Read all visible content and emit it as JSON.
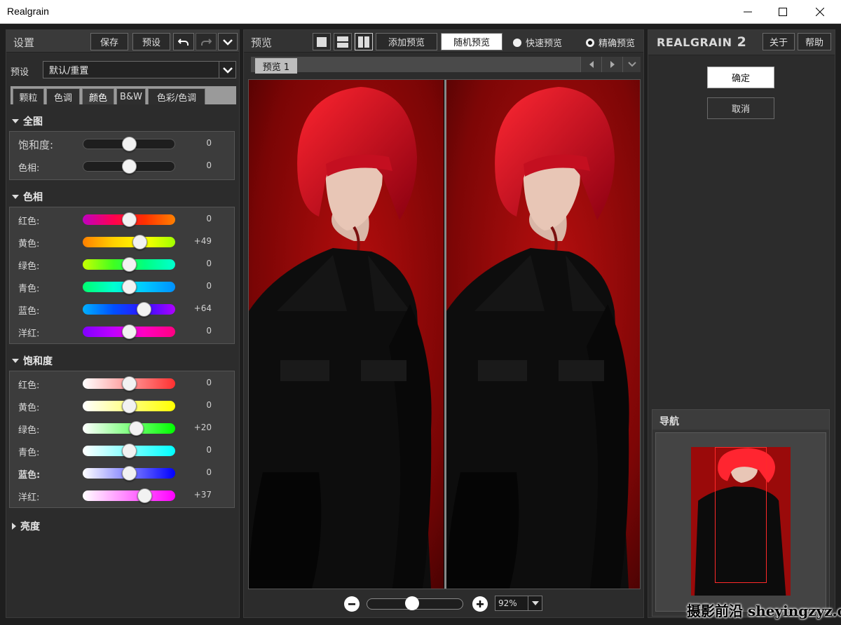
{
  "window": {
    "title": "Realgrain"
  },
  "left": {
    "header": {
      "title": "设置",
      "save_label": "保存",
      "preset_label": "预设"
    },
    "preset": {
      "label": "预设",
      "value": "默认/重置"
    },
    "tabs": [
      "颗粒",
      "色调",
      "颜色",
      "B&W",
      "色彩/色调"
    ],
    "sections": {
      "overall": {
        "title": "全图",
        "rows": [
          {
            "label": "饱和度:",
            "value": "0",
            "level": 0.5
          },
          {
            "label": "色相:",
            "value": "0",
            "level": 0.5
          }
        ]
      },
      "hue": {
        "title": "色相",
        "rows": [
          {
            "label": "红色:",
            "value": "0",
            "level": 0.5,
            "gradient": "linear-gradient(90deg,#c000c0,#ff0050,#ff3000,#ff8000)"
          },
          {
            "label": "黄色:",
            "value": "+49",
            "level": 0.62,
            "gradient": "linear-gradient(90deg,#ff8000,#ffd000,#ffff00,#a0ff00)"
          },
          {
            "label": "绿色:",
            "value": "0",
            "level": 0.5,
            "gradient": "linear-gradient(90deg,#c8ff00,#40ff20,#00ff80,#00ffd0)"
          },
          {
            "label": "青色:",
            "value": "0",
            "level": 0.5,
            "gradient": "linear-gradient(90deg,#00ff70,#00ffd0,#00c8ff,#0090ff)"
          },
          {
            "label": "蓝色:",
            "value": "+64",
            "level": 0.66,
            "gradient": "linear-gradient(90deg,#00b0ff,#0050ff,#3010ff,#b000ff)"
          },
          {
            "label": "洋红:",
            "value": "0",
            "level": 0.5,
            "gradient": "linear-gradient(90deg,#8000ff,#c000ff,#ff00c0,#ff0080)"
          }
        ]
      },
      "saturation": {
        "title": "饱和度",
        "rows": [
          {
            "label": "红色:",
            "value": "0",
            "level": 0.5,
            "gradient": "linear-gradient(90deg,#ffffff,#ff3030)"
          },
          {
            "label": "黄色:",
            "value": "0",
            "level": 0.5,
            "gradient": "linear-gradient(90deg,#ffffff,#ffff00)"
          },
          {
            "label": "绿色:",
            "value": "+20",
            "level": 0.58,
            "gradient": "linear-gradient(90deg,#ffffff,#00ff00)"
          },
          {
            "label": "青色:",
            "value": "0",
            "level": 0.5,
            "gradient": "linear-gradient(90deg,#ffffff,#00ffff)"
          },
          {
            "label": "蓝色:",
            "value": "0",
            "level": 0.5,
            "gradient": "linear-gradient(90deg,#ffffff,#0000ff)"
          },
          {
            "label": "洋红:",
            "value": "+37",
            "level": 0.67,
            "gradient": "linear-gradient(90deg,#ffffff,#ff00ff)"
          }
        ]
      },
      "brightness": {
        "title": "亮度"
      }
    }
  },
  "center": {
    "header": {
      "title": "预览",
      "add_preview": "添加预览",
      "random_preview": "随机预览",
      "fast_preview": "快速预览",
      "precise_preview": "精确预览"
    },
    "tab_label": "预览 1",
    "zoom": {
      "value": "92%",
      "level": 0.47
    }
  },
  "right": {
    "logo_main": "REALGRAIN",
    "logo_num": "2",
    "about_label": "关于",
    "help_label": "帮助",
    "ok_label": "确定",
    "cancel_label": "取消",
    "nav_title": "导航"
  },
  "watermark": "摄影前沿 sheyingzyz.com"
}
